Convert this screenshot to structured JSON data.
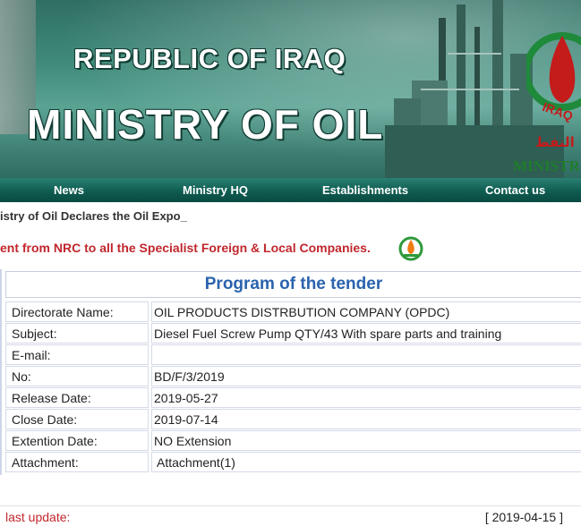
{
  "banner": {
    "title_line1": "REPUBLIC OF IRAQ",
    "title_line2": "MINISTRY OF OIL",
    "logo_text": "IRAQ",
    "ministry_partial": "MINISTR",
    "arabic_partial": "النفط"
  },
  "nav": {
    "items": [
      "News",
      "Ministry HQ",
      "Establishments",
      "Contact us"
    ]
  },
  "news": {
    "line1": "istry of Oil Declares the Oil Expo_",
    "line2": "ent from NRC to all the Specialist Foreign & Local Companies."
  },
  "tender": {
    "heading": "Program of the tender",
    "rows": [
      {
        "label": "Directorate Name:",
        "value": "OIL PRODUCTS DISTRBUTION COMPANY (OPDC)"
      },
      {
        "label": "Subject:",
        "value": "Diesel Fuel Screw Pump QTY/43 With spare parts and training"
      },
      {
        "label": "E-mail:",
        "value": ""
      },
      {
        "label": "No:",
        "value": "BD/F/3/2019"
      },
      {
        "label": "Release Date:",
        "value": "2019-05-27"
      },
      {
        "label": "Close Date:",
        "value": "2019-07-14"
      },
      {
        "label": "Extention Date:",
        "value": "NO Extension"
      },
      {
        "label": "Attachment:",
        "value": "Attachment(1)"
      }
    ]
  },
  "footer": {
    "last_update_label": "last update:",
    "last_update_value": "[ 2019-04-15 ]"
  },
  "colors": {
    "nav_bg": "#0f5c51",
    "heading_blue": "#2a63ad",
    "alert_red": "#c0272d"
  }
}
